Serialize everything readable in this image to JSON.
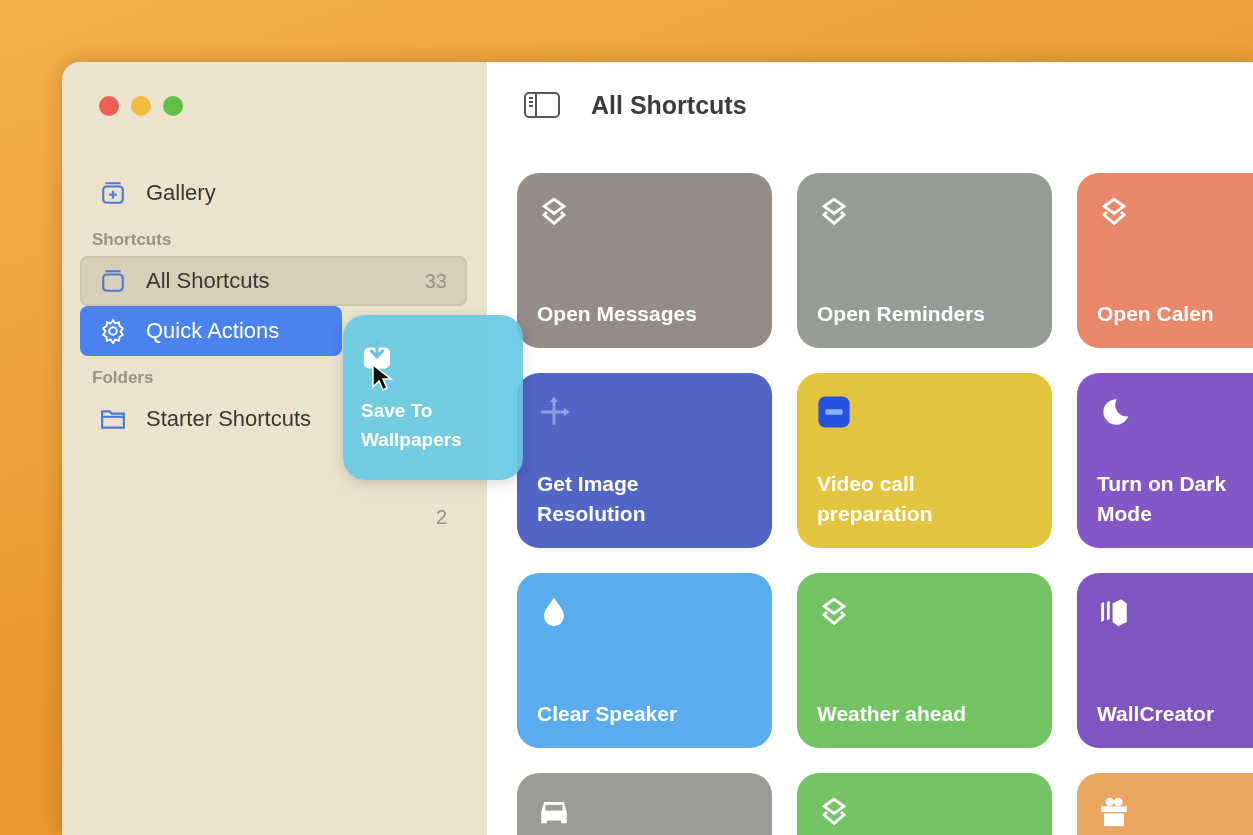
{
  "window": {
    "title": "All Shortcuts"
  },
  "sidebar": {
    "gallery": {
      "label": "Gallery"
    },
    "sections": [
      {
        "title": "Shortcuts",
        "items": [
          {
            "label": "All Shortcuts",
            "kind": "tray",
            "count": "33",
            "selected": true,
            "drop_target": false
          },
          {
            "label": "Quick Actions",
            "kind": "gear",
            "selected": false,
            "drop_target": true
          }
        ]
      },
      {
        "title": "Folders",
        "items": [
          {
            "label": "Starter Shortcuts",
            "kind": "folder",
            "selected": false,
            "drop_target": false
          }
        ]
      }
    ],
    "stray_count": "2"
  },
  "drag_tile": {
    "label": "Save To Wallpapers"
  },
  "shortcuts": [
    {
      "label": "Open Messages",
      "kind": "layers",
      "color": "#958b88"
    },
    {
      "label": "Open Reminders",
      "kind": "layers",
      "color": "#959c95"
    },
    {
      "label": "Open Calen",
      "kind": "layers",
      "color": "#e9876a"
    },
    {
      "label": "Get Image Resolution",
      "kind": "arrows",
      "color": "#5165c4"
    },
    {
      "label": "Video call preparation",
      "kind": "zoom",
      "color": "#e3c43f"
    },
    {
      "label": "Turn on Dark Mode",
      "kind": "moon",
      "color": "#8358c6"
    },
    {
      "label": "Clear Speaker",
      "kind": "drop",
      "color": "#5aacef"
    },
    {
      "label": "Weather ahead",
      "kind": "layers",
      "color": "#73c365"
    },
    {
      "label": "WallCreator",
      "kind": "books",
      "color": "#8055c0"
    },
    {
      "kind": "car",
      "color": "#9a9c98"
    },
    {
      "kind": "layers",
      "color": "#74c467"
    },
    {
      "kind": "gift",
      "color": "#eca55f"
    }
  ]
}
